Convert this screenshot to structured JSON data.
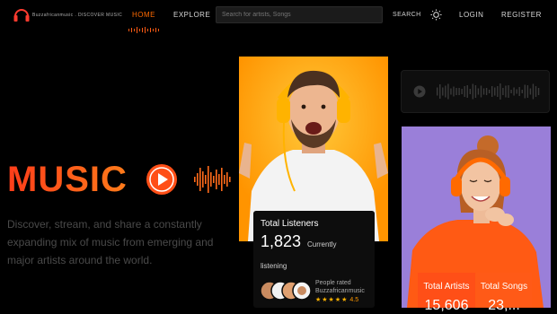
{
  "header": {
    "logo_name": "Buzzafricanmusic",
    "logo_tagline": "Buzzafricanmusic . DISCOVER MUSIC",
    "nav": {
      "home": "HOME",
      "explore": "EXPLORE"
    },
    "search": {
      "placeholder": "Search for artists, Songs",
      "button": "SEARCH"
    },
    "theme_icon": "sun-icon",
    "login": "LOGIN",
    "register": "REGISTER"
  },
  "hero": {
    "title": "MUSIC",
    "description": "Discover, stream, and share a constantly expanding mix of music from emerging and major artists around the world."
  },
  "listeners_card": {
    "title": "Total Listeners",
    "count": "1,823",
    "suffix": "Currently",
    "suffix2": "listening",
    "rated_text": "People rated Buzzafricanmusic",
    "stars": "★★★★★",
    "rating": "4.5"
  },
  "stats": {
    "artists_label": "Total Artists",
    "artists_value": "15,606",
    "songs_label": "Total Songs",
    "songs_value": "23,..."
  },
  "colors": {
    "accent": "#ff5a14",
    "accent_dark": "#ff3d1a",
    "player_bg": "#0e0e0e",
    "main_image_bg": "#ff9800",
    "second_image_bg": "#9a7fd9"
  }
}
